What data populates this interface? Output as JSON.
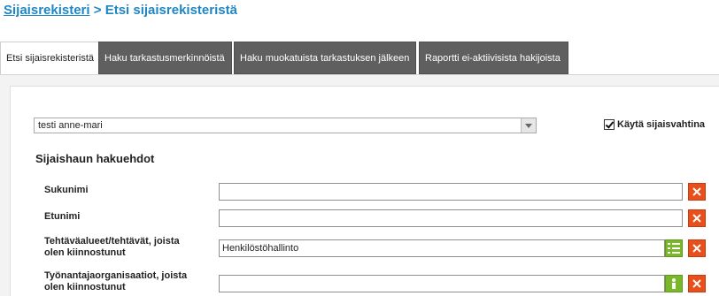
{
  "breadcrumb": {
    "link": "Sijaisrekisteri",
    "separator": " > ",
    "current": "Etsi sijaisrekisteristä"
  },
  "tabs": [
    {
      "label": "Etsi sijaisrekisteristä",
      "active": true
    },
    {
      "label": "Haku tarkastusmerkinnöistä",
      "active": false
    },
    {
      "label": "Haku muokatuista tarkastuksen jälkeen",
      "active": false
    },
    {
      "label": "Raportti ei-aktiivisista hakijoista",
      "active": false
    }
  ],
  "saved_search": {
    "selected": "testi anne-mari"
  },
  "watch": {
    "label": "Käytä sijaisvahtina",
    "checked": true
  },
  "form": {
    "title": "Sijaishaun hakuehdot",
    "fields": [
      {
        "label_line1": "Sukunimi",
        "label_line2": "",
        "value": ""
      },
      {
        "label_line1": "Etunimi",
        "label_line2": "",
        "value": ""
      },
      {
        "label_line1": "Tehtäväalueet/tehtävät, joista",
        "label_line2": "olen kiinnostunut",
        "value": "Henkilöstöhallinto"
      },
      {
        "label_line1": "Työnantajaorganisaatiot, joista",
        "label_line2": "olen kiinnostunut",
        "value": ""
      }
    ]
  },
  "colors": {
    "accent": "#1f86c4",
    "clear_button": "#e94e1b",
    "picker_button": "#7ab829",
    "inactive_tab": "#5f5f5f"
  },
  "icons": {
    "clear": "close-x-icon",
    "list_picker": "list-icon",
    "org_picker": "person-icon",
    "dropdown": "chevron-down-icon"
  }
}
